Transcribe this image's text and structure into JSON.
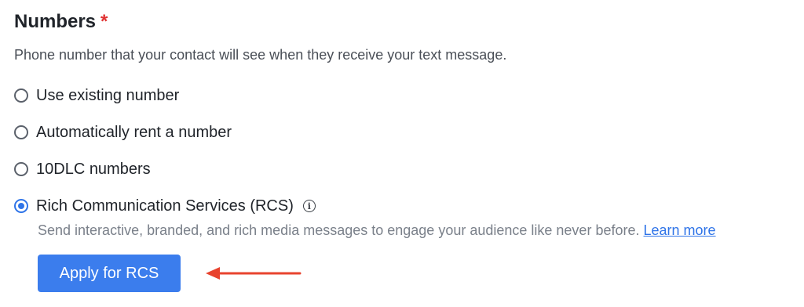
{
  "field": {
    "title": "Numbers",
    "required_mark": "*",
    "description": "Phone number that your contact will see when they receive your text message."
  },
  "options": [
    {
      "label": "Use existing number",
      "selected": false
    },
    {
      "label": "Automatically rent a number",
      "selected": false
    },
    {
      "label": "10DLC numbers",
      "selected": false
    },
    {
      "label": "Rich Communication Services (RCS)",
      "selected": true
    }
  ],
  "rcs": {
    "info_icon_glyph": "i",
    "description": "Send interactive, branded, and rich media messages to engage your audience like never before.",
    "learn_more": "Learn more",
    "apply_button": "Apply for RCS"
  },
  "colors": {
    "accent": "#3b7ded",
    "required": "#e03131",
    "annotation_arrow": "#e8432e"
  }
}
